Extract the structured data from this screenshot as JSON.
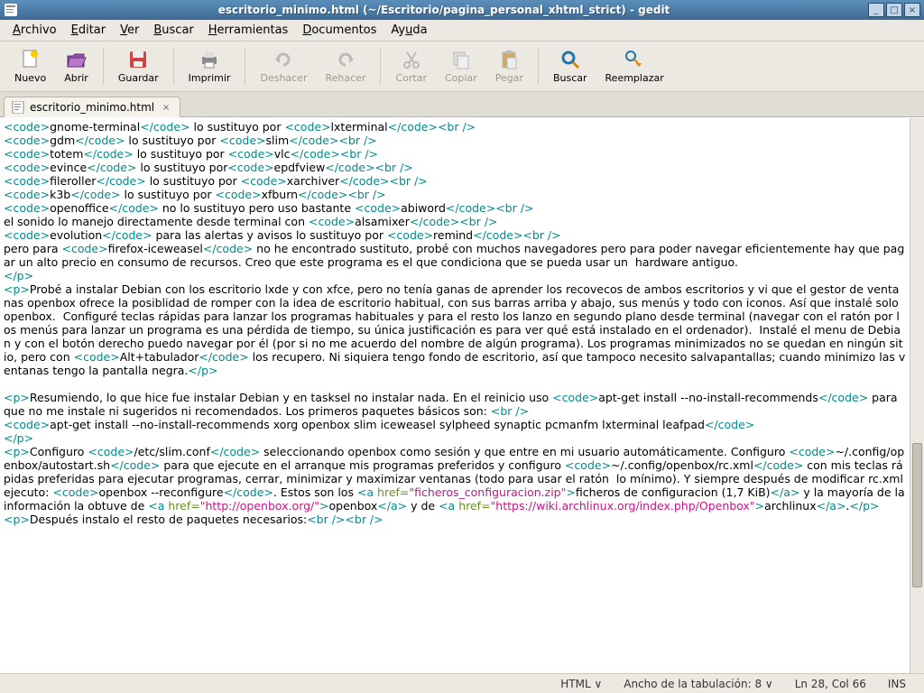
{
  "window": {
    "title": "escritorio_minimo.html (~/Escritorio/pagina_personal_xhtml_strict) - gedit"
  },
  "menu": {
    "items": [
      "Archivo",
      "Editar",
      "Ver",
      "Buscar",
      "Herramientas",
      "Documentos",
      "Ayuda"
    ]
  },
  "toolbar": {
    "nuevo": "Nuevo",
    "abrir": "Abrir",
    "guardar": "Guardar",
    "imprimir": "Imprimir",
    "deshacer": "Deshacer",
    "rehacer": "Rehacer",
    "cortar": "Cortar",
    "copiar": "Copiar",
    "pegar": "Pegar",
    "buscar": "Buscar",
    "reemplazar": "Reemplazar"
  },
  "tab": {
    "label": "escritorio_minimo.html"
  },
  "status": {
    "lang": "HTML",
    "tab": "Ancho de la tabulación: 8",
    "pos": "Ln 28, Col 66",
    "ins": "INS"
  },
  "code": {
    "l1a": "<code>",
    "l1b": "gnome-terminal",
    "l1c": "</code>",
    "l1d": " lo sustituyo por ",
    "l1e": "<code>",
    "l1f": "lxterminal",
    "l1g": "</code><br />",
    "l2a": "<code>",
    "l2b": "gdm",
    "l2c": "</code>",
    "l2d": " lo sustituyo por ",
    "l2e": "<code>",
    "l2f": "slim",
    "l2g": "</code><br />",
    "l3a": "<code>",
    "l3b": "totem",
    "l3c": "</code>",
    "l3d": " lo sustituyo por ",
    "l3e": "<code>",
    "l3f": "vlc",
    "l3g": "</code><br />",
    "l4a": "<code>",
    "l4b": "evince",
    "l4c": "</code>",
    "l4d": " lo sustituyo por",
    "l4e": "<code>",
    "l4f": "epdfview",
    "l4g": "</code><br />",
    "l5a": "<code>",
    "l5b": "fileroller",
    "l5c": "</code>",
    "l5d": " lo sustituyo por ",
    "l5e": "<code>",
    "l5f": "xarchiver",
    "l5g": "</code><br />",
    "l6a": "<code>",
    "l6b": "k3b",
    "l6c": "</code>",
    "l6d": " lo sustituyo por ",
    "l6e": "<code>",
    "l6f": "xfburn",
    "l6g": "</code><br />",
    "l7a": "<code>",
    "l7b": "openoffice",
    "l7c": "</code>",
    "l7d": " no lo sustituyo pero uso bastante ",
    "l7e": "<code>",
    "l7f": "abiword",
    "l7g": "</code><br />",
    "l8a": "el sonido lo manejo directamente desde terminal con ",
    "l8b": "<code>",
    "l8c": "alsamixer",
    "l8d": "</code><br />",
    "l9a": "<code>",
    "l9b": "evolution",
    "l9c": "</code>",
    "l9d": " para las alertas y avisos lo sustituyo por ",
    "l9e": "<code>",
    "l9f": "remind",
    "l9g": "</code><br />",
    "l10a": "pero para ",
    "l10b": "<code>",
    "l10c": "firefox-iceweasel",
    "l10d": "</code>",
    "l10e": " no he encontrado sustituto, probé con muchos navegadores pero para poder navegar eficientemente hay que pagar un alto precio en consumo de recursos. Creo que este programa es el que condiciona que se pueda usar un  hardware antiguo.",
    "l11": "</p>",
    "l12a": "<p>",
    "l12b": "Probé a instalar Debian con los escritorio lxde y con xfce, pero no tenía ganas de aprender los recovecos de ambos escritorios y vi que el gestor de ventanas openbox ofrece la posiblidad de romper con la idea de escritorio habitual, con sus barras arriba y abajo, sus menús y todo con iconos. Así que instalé solo openbox.  Configuré teclas rápidas para lanzar los programas habituales y para el resto los lanzo en segundo plano desde terminal (navegar con el ratón por los menús para lanzar un programa es una pérdida de tiempo, su única justificación es para ver qué está instalado en el ordenador).  Instalé el menu de Debian y con el botón derecho puedo navegar por él (por si no me acuerdo del nombre de algún programa). Los programas minimizados no se quedan en ningún sitio, pero con ",
    "l12c": "<code>",
    "l12d": "Alt+tabulador",
    "l12e": "</code>",
    "l12f": " los recupero. Ni siquiera tengo fondo de escritorio, así que tampoco necesito salvapantallas; cuando minimizo las ventanas tengo la pantalla negra.",
    "l12g": "</p>",
    "l13": "",
    "l14a": "<p>",
    "l14b": "Resumiendo, lo que hice fue instalar Debian y en tasksel no instalar nada. En el reinicio uso ",
    "l14c": "<code>",
    "l14d": "apt-get install --no-install-recommends",
    "l14e": "</code>",
    "l14f": " para que no me instale ni sugeridos ni recomendados. Los primeros paquetes básicos son: ",
    "l14g": "<br />",
    "l15a": "<code>",
    "l15b": "apt-get install --no-install-recommends xorg openbox slim iceweasel sylpheed synaptic pcmanfm lxterminal leafpad",
    "l15c": "</code>",
    "l16": "</p>",
    "l17a": "<p>",
    "l17b": "Configuro ",
    "l17c": "<code>",
    "l17d": "/etc/slim.conf",
    "l17e": "</code>",
    "l17f": " seleccionando openbox como sesión y que entre en mi usuario automáticamente. Configuro ",
    "l17g": "<code>",
    "l17h": "~/.config/openbox/autostart.sh",
    "l17i": "</code>",
    "l17j": " para que ejecute en el arranque mis programas preferidos y configuro ",
    "l17k": "<code>",
    "l17l": "~/.config/openbox/rc.xml",
    "l17m": "</code>",
    "l17n": " con mis teclas rápidas preferidas para ejecutar programas, cerrar, minimizar y maximizar ventanas (todo para usar el ratón  lo mínimo). Y siempre después de modificar rc.xml ejecuto: ",
    "l17o": "<code>",
    "l17p": "openbox --reconfigure",
    "l17q": "</code>",
    "l17r": ". Estos son los ",
    "l17s": "<a ",
    "l17t": "href=",
    "l17u": "\"ficheros_configuracion.zip\"",
    "l17v": ">",
    "l17w": "ficheros de configuracion (1,7 KiB)",
    "l17x": "</a>",
    "l17y": " y la mayoría de la información la obtuve de ",
    "l17z": "<a ",
    "l17aa": "href=",
    "l17ab": "\"http://openbox.org/\"",
    "l17ac": ">",
    "l17ad": "openbox",
    "l17ae": "</a>",
    "l17af": " y de ",
    "l17ag": "<a ",
    "l17ah": "href=",
    "l17ai": "\"https://wiki.archlinux.org/index.php/Openbox\"",
    "l17aj": ">",
    "l17ak": "archlinux",
    "l17al": "</a>",
    "l17am": ".",
    "l17an": "</p>",
    "l18a": "<p>",
    "l18b": "Después instalo el resto de paquetes necesarios:",
    "l18c": "<br /><br />"
  }
}
